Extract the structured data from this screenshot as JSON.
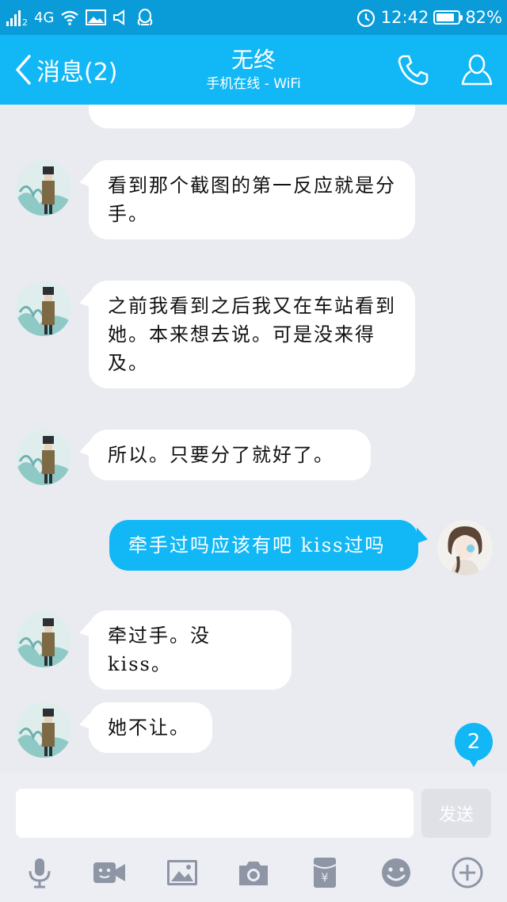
{
  "status_bar": {
    "sim": "2",
    "network": "4G",
    "time": "12:42",
    "battery": "82%",
    "battery_level": 0.82
  },
  "header": {
    "back_label": "消息(2)",
    "title": "无终",
    "subtitle": "手机在线 - WiFi"
  },
  "messages": [
    {
      "side": "in",
      "text": ""
    },
    {
      "side": "in",
      "text": "看到那个截图的第一反应就是分手。"
    },
    {
      "side": "in",
      "text": "之前我看到之后我又在车站看到她。本来想去说。可是没来得及。"
    },
    {
      "side": "in",
      "text": "所以。只要分了就好了。"
    },
    {
      "side": "out",
      "text": "牵手过吗应该有吧 kiss过吗"
    },
    {
      "side": "in",
      "text": "牵过手。没kiss。"
    },
    {
      "side": "in",
      "text": "她不让。"
    }
  ],
  "unread_count": "2",
  "composer": {
    "value": "",
    "placeholder": "",
    "send_label": "发送"
  },
  "toolbar_icons": [
    "microphone-icon",
    "video-icon",
    "image-icon",
    "camera-icon",
    "red-packet-icon",
    "emoji-icon",
    "plus-icon"
  ],
  "colors": {
    "status_bar": "#0a9bd9",
    "header": "#12b7f5",
    "chat_background": "#e9ebf1",
    "outgoing_bubble": "#12b7f5",
    "incoming_bubble": "#ffffff"
  }
}
